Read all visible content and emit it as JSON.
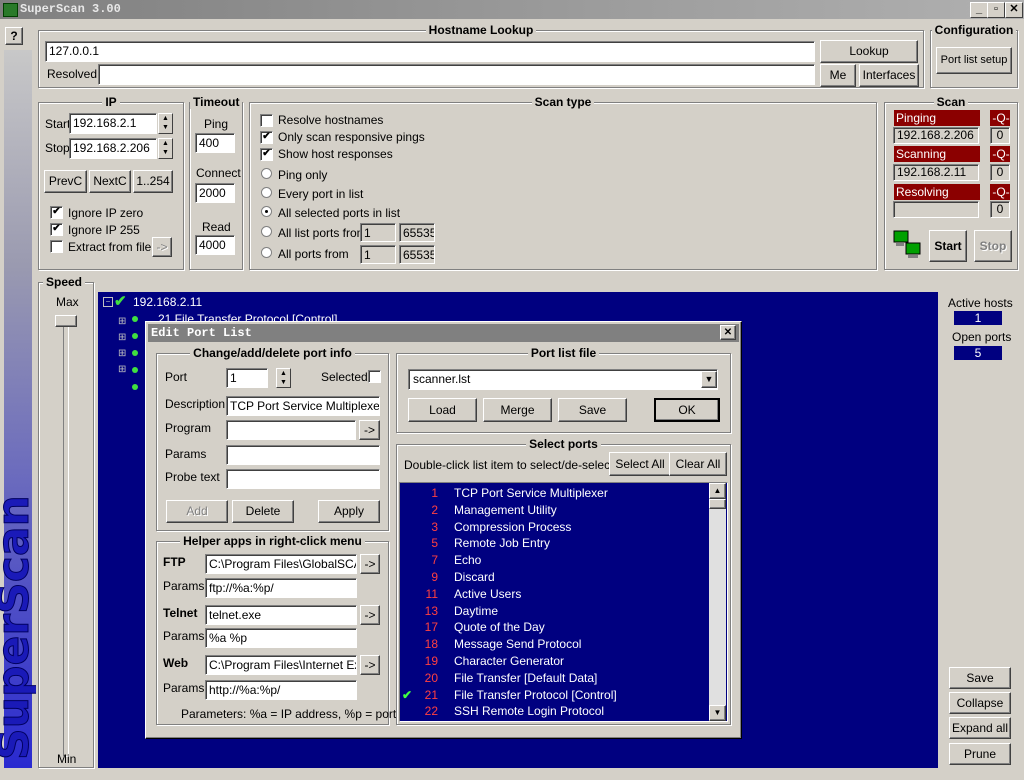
{
  "window": {
    "title": "SuperScan 3.00",
    "help": "?",
    "sidebar_brand": "SuperScan"
  },
  "hostname": {
    "title": "Hostname Lookup",
    "host_value": "127.0.0.1",
    "resolved_label": "Resolved",
    "resolved_value": "",
    "lookup_btn": "Lookup",
    "me_btn": "Me",
    "interfaces_btn": "Interfaces"
  },
  "config": {
    "title": "Configuration",
    "port_setup_btn": "Port list setup"
  },
  "ip": {
    "title": "IP",
    "start_label": "Start",
    "start_value": "192.168.2.1",
    "stop_label": "Stop",
    "stop_value": "192.168.2.206",
    "prevc": "PrevC",
    "nextc": "NextC",
    "range": "1..254",
    "ignore_zero": "Ignore IP zero",
    "ignore_255": "Ignore IP 255",
    "extract": "Extract from file",
    "extract_btn": "->"
  },
  "timeout": {
    "title": "Timeout",
    "ping_label": "Ping",
    "ping_value": "400",
    "connect_label": "Connect",
    "connect_value": "2000",
    "read_label": "Read",
    "read_value": "4000"
  },
  "scantype": {
    "title": "Scan type",
    "resolve": "Resolve hostnames",
    "responsive": "Only scan responsive pings",
    "show_resp": "Show host responses",
    "ping_only": "Ping only",
    "every_port": "Every port in list",
    "all_selected": "All selected ports in list",
    "all_list_from": "All list ports from",
    "all_ports_from": "All ports from",
    "from1": "1",
    "to1": "65535",
    "from2": "1",
    "to2": "65535"
  },
  "scan": {
    "title": "Scan",
    "pinging": "Pinging",
    "pinging_q": "-Q-",
    "pinging_ip": "192.168.2.206",
    "pinging_n": "0",
    "scanning": "Scanning",
    "scanning_q": "-Q-",
    "scanning_ip": "192.168.2.11",
    "scanning_n": "0",
    "resolving": "Resolving",
    "resolving_q": "-Q-",
    "resolving_ip": "",
    "resolving_n": "0",
    "start_btn": "Start",
    "stop_btn": "Stop"
  },
  "speed": {
    "title": "Speed",
    "max": "Max",
    "min": "Min"
  },
  "tree": {
    "root": "192.168.2.11",
    "first_child": "21 File Transfer Protocol [Control]"
  },
  "stats": {
    "active_label": "Active hosts",
    "active_value": "1",
    "open_label": "Open ports",
    "open_value": "5",
    "save": "Save",
    "collapse": "Collapse all",
    "expand": "Expand all",
    "prune": "Prune"
  },
  "dialog": {
    "title": "Edit Port List",
    "close": "✕",
    "change": {
      "title": "Change/add/delete port info",
      "port_label": "Port",
      "port_value": "1",
      "selected_label": "Selected",
      "desc_label": "Description",
      "desc_value": "TCP Port Service Multiplexer",
      "program_label": "Program",
      "program_value": "",
      "params_label": "Params",
      "params_value": "",
      "probe_label": "Probe text",
      "probe_value": "",
      "browse": "->",
      "add": "Add",
      "delete": "Delete",
      "apply": "Apply"
    },
    "helper": {
      "title": "Helper apps in right-click menu",
      "ftp_label": "FTP",
      "ftp_value": "C:\\Program Files\\GlobalSCAPE",
      "ftp_params": "ftp://%a:%p/",
      "telnet_label": "Telnet",
      "telnet_value": "telnet.exe",
      "telnet_params": "%a %p",
      "web_label": "Web",
      "web_value": "C:\\Program Files\\Internet Explc",
      "web_params": "http://%a:%p/",
      "params_label": "Params",
      "browse": "->",
      "note": "Parameters: %a = IP address, %p = port"
    },
    "portfile": {
      "title": "Port list file",
      "file": "scanner.lst",
      "load": "Load",
      "merge": "Merge",
      "save": "Save",
      "ok": "OK"
    },
    "select": {
      "title": "Select ports",
      "hint": "Double-click list item to select/de-select",
      "select_all": "Select All",
      "clear_all": "Clear All"
    },
    "ports": [
      {
        "n": "1",
        "d": "TCP Port Service Multiplexer",
        "c": ""
      },
      {
        "n": "2",
        "d": "Management Utility",
        "c": ""
      },
      {
        "n": "3",
        "d": "Compression Process",
        "c": ""
      },
      {
        "n": "5",
        "d": "Remote Job Entry",
        "c": ""
      },
      {
        "n": "7",
        "d": "Echo",
        "c": ""
      },
      {
        "n": "9",
        "d": "Discard",
        "c": ""
      },
      {
        "n": "11",
        "d": "Active Users",
        "c": ""
      },
      {
        "n": "13",
        "d": "Daytime",
        "c": ""
      },
      {
        "n": "17",
        "d": "Quote of the Day",
        "c": ""
      },
      {
        "n": "18",
        "d": "Message Send Protocol",
        "c": ""
      },
      {
        "n": "19",
        "d": "Character Generator",
        "c": ""
      },
      {
        "n": "20",
        "d": "File Transfer [Default Data]",
        "c": ""
      },
      {
        "n": "21",
        "d": "File Transfer Protocol [Control]",
        "c": "✔"
      },
      {
        "n": "22",
        "d": "SSH Remote Login Protocol",
        "c": ""
      }
    ]
  }
}
